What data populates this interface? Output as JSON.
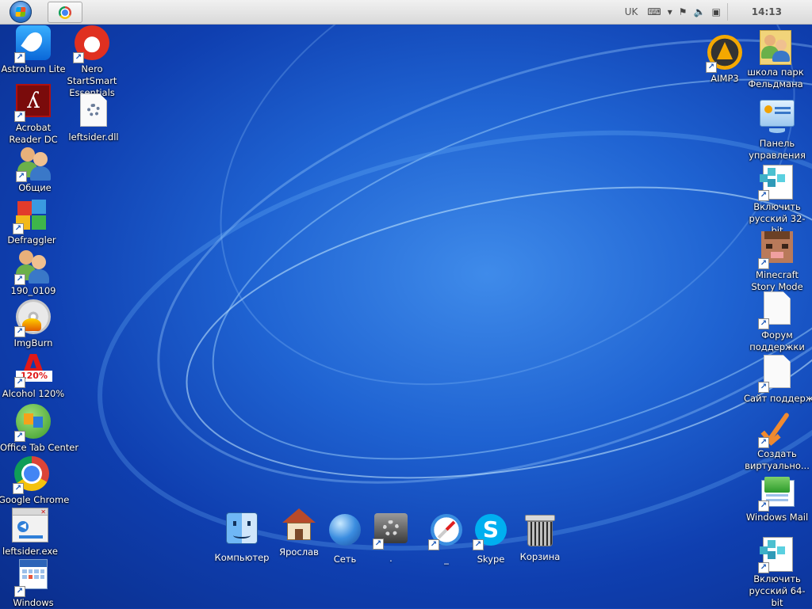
{
  "taskbar": {
    "start_button": "Start",
    "language": "UK",
    "clock": "14:13"
  },
  "desktop_left": [
    {
      "label": "Astroburn Lite",
      "icon": "astroburn-icon"
    },
    {
      "label": "Nero StartSmart Essentials",
      "icon": "nero-icon"
    },
    {
      "label": "Acrobat Reader DC",
      "icon": "acrobat-icon"
    },
    {
      "label": "leftsider.dll",
      "icon": "dll-file-icon"
    },
    {
      "label": "Общие",
      "icon": "users-icon"
    },
    {
      "label": "Defraggler",
      "icon": "defraggler-icon"
    },
    {
      "label": "190_0109",
      "icon": "users-icon"
    },
    {
      "label": "ImgBurn",
      "icon": "imgburn-icon"
    },
    {
      "label": "Alcohol 120%",
      "icon": "alcohol-icon"
    },
    {
      "label": "Office Tab Center",
      "icon": "office-tab-icon"
    },
    {
      "label": "Google Chrome",
      "icon": "chrome-icon"
    },
    {
      "label": "leftsider.exe",
      "icon": "exe-window-icon"
    },
    {
      "label": "Windows",
      "icon": "calendar-icon"
    }
  ],
  "desktop_right": [
    {
      "label": "AIMP3",
      "icon": "aimp-icon"
    },
    {
      "label": "школа парк Фельдмана",
      "icon": "users-icon"
    },
    {
      "label": "Панель управления",
      "icon": "control-panel-icon"
    },
    {
      "label": "Включить русский 32-bit",
      "icon": "registry-icon"
    },
    {
      "label": "Minecraft Story Mode",
      "icon": "minecraft-icon"
    },
    {
      "label": "Форум поддержки",
      "icon": "document-icon"
    },
    {
      "label": "Сайт поддержки",
      "icon": "document-icon"
    },
    {
      "label": "Создать виртуально...",
      "icon": "checkmark-icon"
    },
    {
      "label": "Windows Mail",
      "icon": "mail-icon"
    },
    {
      "label": "Включить русский 64-bit",
      "icon": "registry-icon"
    }
  ],
  "dock": [
    {
      "label": "Компьютер",
      "icon": "finder-icon"
    },
    {
      "label": "Ярослав",
      "icon": "home-icon"
    },
    {
      "label": "Сеть",
      "icon": "globe-icon"
    },
    {
      "label": ".",
      "icon": "settings-icon"
    },
    {
      "label": "_",
      "icon": "safari-icon"
    },
    {
      "label": "Skype",
      "icon": "skype-icon"
    },
    {
      "label": "Корзина",
      "icon": "trash-icon"
    }
  ]
}
